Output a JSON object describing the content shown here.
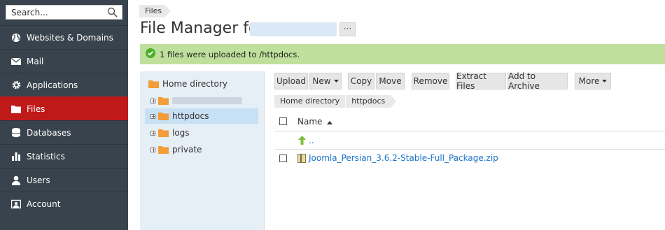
{
  "search": {
    "placeholder": "Search..."
  },
  "nav": [
    {
      "label": "Websites & Domains",
      "icon": "globe-icon"
    },
    {
      "label": "Mail",
      "icon": "envelope-icon"
    },
    {
      "label": "Applications",
      "icon": "gear-icon"
    },
    {
      "label": "Files",
      "icon": "folder-icon",
      "active": true
    },
    {
      "label": "Databases",
      "icon": "database-icon"
    },
    {
      "label": "Statistics",
      "icon": "bar-chart-icon"
    },
    {
      "label": "Users",
      "icon": "user-icon"
    },
    {
      "label": "Account",
      "icon": "account-icon"
    }
  ],
  "breadcrumb": {
    "label": "Files"
  },
  "page": {
    "title": "File Manager for",
    "more_label": "···"
  },
  "alert": {
    "text": "1 files were uploaded to /httpdocs."
  },
  "tree": {
    "root": "Home directory",
    "items": [
      "httpdocs",
      "logs",
      "private"
    ]
  },
  "toolbar": {
    "upload": "Upload",
    "new": "New",
    "copy": "Copy",
    "move": "Move",
    "remove": "Remove",
    "extract": "Extract Files",
    "archive": "Add to Archive",
    "more": "More"
  },
  "path": [
    "Home directory",
    "httpdocs"
  ],
  "table": {
    "name_header": "Name",
    "up_label": "..",
    "files": [
      "Joomla_Persian_3.6.2-Stable-Full_Package.zip"
    ]
  },
  "colors": {
    "sidebar": "#39434d",
    "active": "#c0191a",
    "alert": "#bfe09c",
    "link": "#1c73c9",
    "folder": "#f39c3a"
  }
}
